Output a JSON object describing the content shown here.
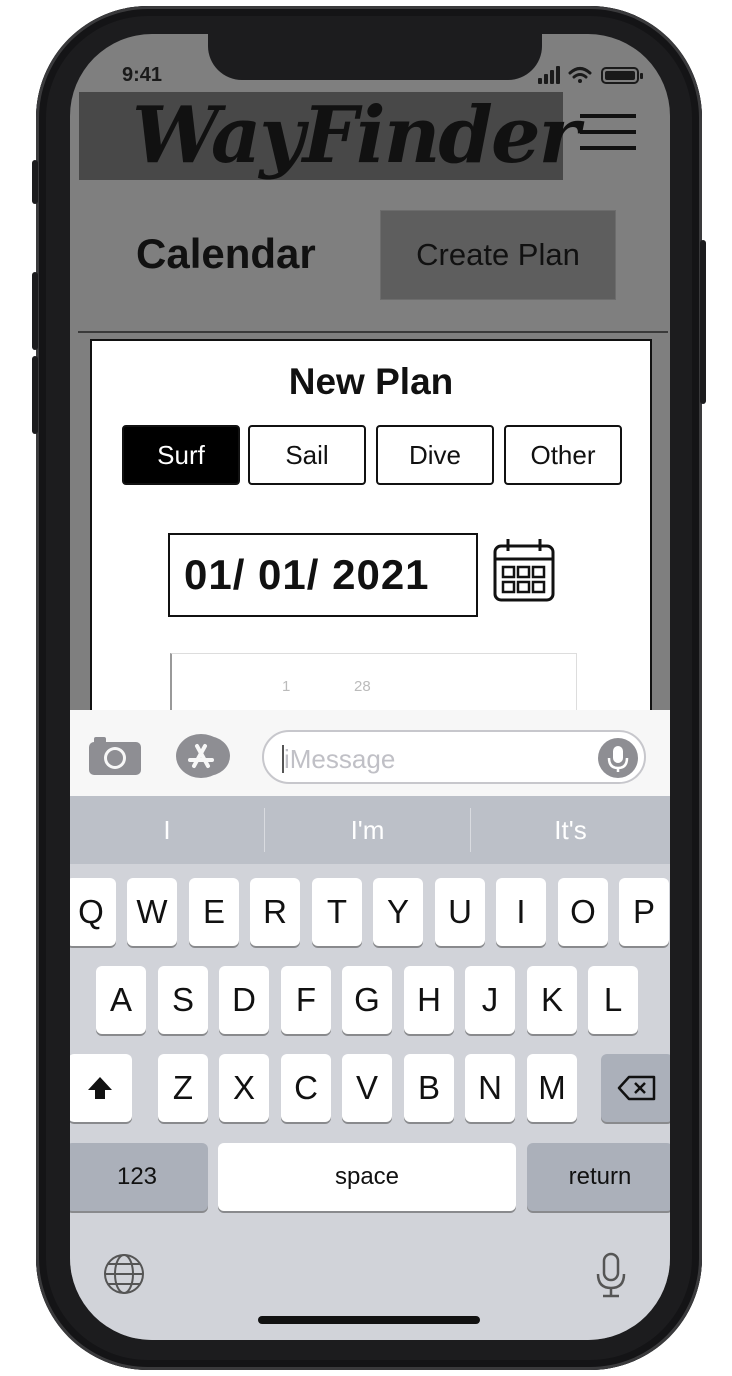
{
  "status_bar": {
    "time": "9:41"
  },
  "header": {
    "logo": "WayFinder",
    "title": "Calendar",
    "create_plan_label": "Create Plan"
  },
  "new_plan": {
    "title": "New Plan",
    "activities": [
      {
        "label": "Surf",
        "selected": true
      },
      {
        "label": "Sail",
        "selected": false
      },
      {
        "label": "Dive",
        "selected": false
      },
      {
        "label": "Other",
        "selected": false
      }
    ],
    "date_value": "01/ 01/ 2021",
    "picker_fragments": [
      "1",
      "28"
    ]
  },
  "message_bar": {
    "placeholder": "iMessage"
  },
  "keyboard": {
    "suggestions": [
      "I",
      "I'm",
      "It's"
    ],
    "row1": [
      "Q",
      "W",
      "E",
      "R",
      "T",
      "Y",
      "U",
      "I",
      "O",
      "P"
    ],
    "row2": [
      "A",
      "S",
      "D",
      "F",
      "G",
      "H",
      "J",
      "K",
      "L"
    ],
    "row3": [
      "Z",
      "X",
      "C",
      "V",
      "B",
      "N",
      "M"
    ],
    "numbers_label": "123",
    "space_label": "space",
    "return_label": "return"
  },
  "colors": {
    "background_gray": "#7f7f7f",
    "logo_box": "#484848",
    "button_dark": "#5e5e5e",
    "selected_segment": "#000000",
    "keyboard": "#d1d3d9"
  }
}
